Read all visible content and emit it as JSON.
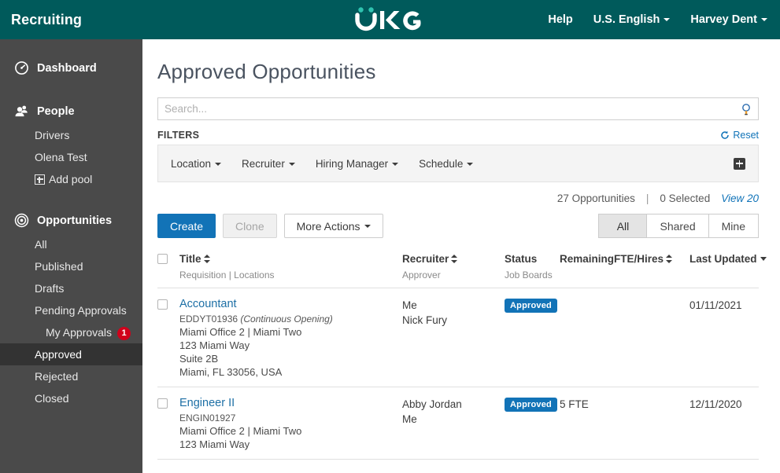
{
  "header": {
    "app_title": "Recruiting",
    "logo_text": "UKG",
    "nav": [
      {
        "label": "Help",
        "has_caret": false
      },
      {
        "label": "U.S. English",
        "has_caret": true
      },
      {
        "label": "Harvey Dent",
        "has_caret": true
      }
    ]
  },
  "sidebar": {
    "groups": [
      {
        "label": "Dashboard",
        "icon": "gauge-icon",
        "items": []
      },
      {
        "label": "People",
        "icon": "people-icon",
        "items": [
          {
            "label": "Drivers",
            "active": false,
            "plus": false
          },
          {
            "label": "Olena Test",
            "active": false,
            "plus": false
          },
          {
            "label": "Add pool",
            "active": false,
            "plus": true
          }
        ]
      },
      {
        "label": "Opportunities",
        "icon": "target-icon",
        "items": [
          {
            "label": "All",
            "active": false,
            "plus": false
          },
          {
            "label": "Published",
            "active": false,
            "plus": false
          },
          {
            "label": "Drafts",
            "active": false,
            "plus": false
          },
          {
            "label": "Pending Approvals",
            "active": false,
            "plus": false
          },
          {
            "label": "My Approvals",
            "active": false,
            "plus": false,
            "indent": true,
            "badge": "1"
          },
          {
            "label": "Approved",
            "active": true,
            "plus": false
          },
          {
            "label": "Rejected",
            "active": false,
            "plus": false
          },
          {
            "label": "Closed",
            "active": false,
            "plus": false
          }
        ]
      }
    ]
  },
  "main": {
    "page_title": "Approved Opportunities",
    "search": {
      "value": "",
      "placeholder": "Search...",
      "icon": "search-icon"
    },
    "filters": {
      "label": "FILTERS",
      "reset_label": "Reset",
      "reset_icon": "refresh-icon",
      "add_icon": "plus-icon",
      "items": [
        {
          "label": "Location"
        },
        {
          "label": "Recruiter"
        },
        {
          "label": "Hiring Manager"
        },
        {
          "label": "Schedule"
        }
      ]
    },
    "summary": {
      "count": "27 Opportunities",
      "divider": "|",
      "selected": "0 Selected",
      "view_label": "View 20"
    },
    "actions": {
      "create": "Create",
      "clone": "Clone",
      "more": "More Actions"
    },
    "scope_tabs": [
      {
        "label": "All",
        "active": true
      },
      {
        "label": "Shared",
        "active": false
      },
      {
        "label": "Mine",
        "active": false
      }
    ],
    "table": {
      "headers": {
        "title": "Title",
        "title_sub": "Requisition | Locations",
        "recruiter": "Recruiter",
        "recruiter_sub": "Approver",
        "status": "Status",
        "status_sub": "Job Boards",
        "fte": "RemainingFTE/Hires",
        "updated": "Last Updated"
      },
      "rows": [
        {
          "title": "Accountant",
          "requisition": "EDDYT01936",
          "requisition_note": "(Continuous Opening)",
          "location_lines": [
            "Miami Office 2 | Miami Two",
            "123 Miami Way",
            "Suite 2B",
            "Miami, FL 33056, USA"
          ],
          "recruiter": "Me",
          "approver": "Nick Fury",
          "status": "Approved",
          "fte": "",
          "updated": "01/11/2021"
        },
        {
          "title": "Engineer II",
          "requisition": "ENGIN01927",
          "requisition_note": "",
          "location_lines": [
            "Miami Office 2 | Miami Two",
            "123 Miami Way"
          ],
          "recruiter": "Abby Jordan",
          "approver": "Me",
          "status": "Approved",
          "fte": "5 FTE",
          "updated": "12/11/2020"
        }
      ]
    }
  },
  "colors": {
    "header_teal": "#005a5b",
    "logo_accent": "#2fc3b0",
    "sidebar": "#4a4a4a",
    "sidebar_active": "#333333",
    "primary_blue": "#1273b7",
    "link_blue": "#1073b8",
    "badge_red": "#d0021b"
  }
}
